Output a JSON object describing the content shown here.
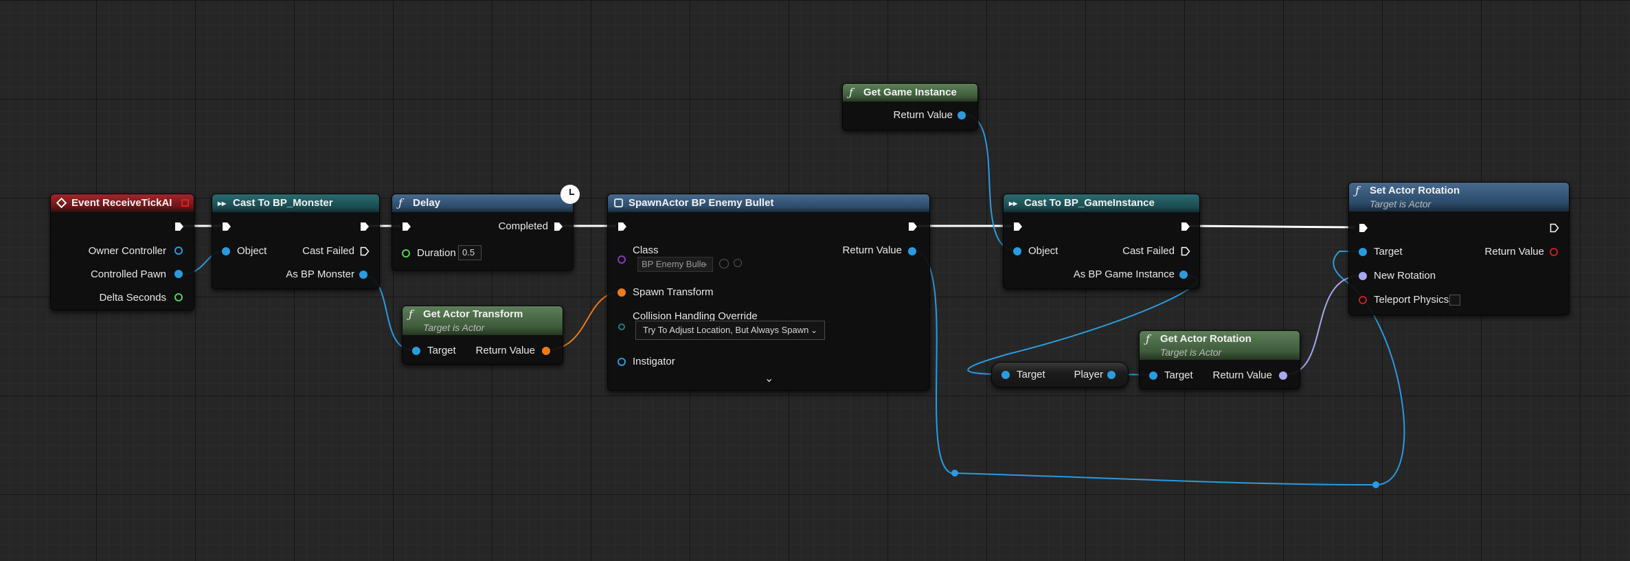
{
  "nodes": {
    "event_tick": {
      "title": "Event ReceiveTickAI",
      "pins": {
        "owner_controller": "Owner Controller",
        "controlled_pawn": "Controlled Pawn",
        "delta_seconds": "Delta Seconds"
      }
    },
    "cast_monster": {
      "title": "Cast To BP_Monster",
      "pins": {
        "object": "Object",
        "cast_failed": "Cast Failed",
        "as_bp_monster": "As BP Monster"
      }
    },
    "delay": {
      "title": "Delay",
      "pins": {
        "completed": "Completed",
        "duration": "Duration"
      },
      "duration_value": "0.5"
    },
    "get_actor_transform": {
      "title": "Get Actor Transform",
      "subtitle": "Target is Actor",
      "pins": {
        "target": "Target",
        "return_value": "Return Value"
      }
    },
    "spawn_actor": {
      "title": "SpawnActor BP Enemy Bullet",
      "pins": {
        "class": "Class",
        "return_value": "Return Value",
        "spawn_transform": "Spawn Transform",
        "collision": "Collision Handling Override",
        "instigator": "Instigator"
      },
      "class_value": "BP Enemy Bulle",
      "collision_value": "Try To Adjust Location, But Always Spawn"
    },
    "get_game_instance": {
      "title": "Get Game Instance",
      "pins": {
        "return_value": "Return Value"
      }
    },
    "cast_game_instance": {
      "title": "Cast To BP_GameInstance",
      "pins": {
        "object": "Object",
        "cast_failed": "Cast Failed",
        "as_bp_game_instance": "As BP Game Instance"
      }
    },
    "player_get": {
      "pins": {
        "target": "Target",
        "player": "Player"
      }
    },
    "get_actor_rotation": {
      "title": "Get Actor Rotation",
      "subtitle": "Target is Actor",
      "pins": {
        "target": "Target",
        "return_value": "Return Value"
      }
    },
    "set_actor_rotation": {
      "title": "Set Actor Rotation",
      "subtitle": "Target is Actor",
      "pins": {
        "target": "Target",
        "return_value": "Return Value",
        "new_rotation": "New Rotation",
        "teleport_physics": "Teleport Physics"
      }
    }
  },
  "colors": {
    "exec": "#ffffff",
    "object": "#2b9be0",
    "float": "#55d255",
    "transform": "#f07a18",
    "class": "#8b3ab8",
    "rotator": "#a8a8f0",
    "bool": "#c81e1e"
  },
  "icons": {
    "event": "event-diamond-icon",
    "cast": "cast-arrows-icon",
    "function": "function-f-icon",
    "spawn": "spawn-actor-icon",
    "latent": "clock-icon",
    "dropdown": "chevron-down-icon",
    "browse": "magnifier-icon",
    "use": "use-selected-arrow-icon",
    "expand": "expand-chevron-icon"
  }
}
